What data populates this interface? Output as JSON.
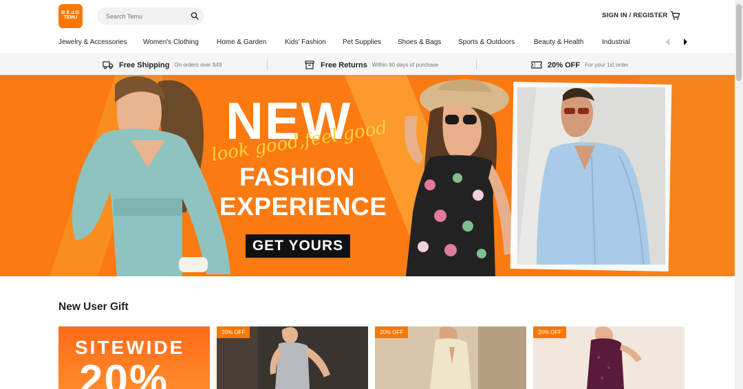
{
  "header": {
    "logo_line1": "⊠⊻⊿⊡",
    "logo_line2": "TEMU",
    "search_placeholder": "Search Temu",
    "signin_label": "SIGN IN / REGISTER"
  },
  "categories": [
    "Jewelry & Accessories",
    "Women's Clothing",
    "Home & Garden",
    "Kids' Fashion",
    "Pet Supplies",
    "Shoes & Bags",
    "Sports & Outdoors",
    "Beauty & Health",
    "Industrial"
  ],
  "benefits": [
    {
      "title": "Free Shipping",
      "sub": "On orders over $49",
      "icon": "truck-icon"
    },
    {
      "title": "Free Returns",
      "sub": "Within 90 days of purchase",
      "icon": "return-box-icon"
    },
    {
      "title": "20% OFF",
      "sub": "For your 1st order",
      "icon": "coupon-icon"
    }
  ],
  "banner": {
    "title": "NEW",
    "script": "look good,feel good",
    "subtitle1": "FASHION",
    "subtitle2": "EXPERIENCE",
    "cta": "GET YOURS"
  },
  "section": {
    "title": "New User Gift",
    "promo_text": "SITEWIDE",
    "promo_big": "20%",
    "cards": [
      {
        "badge": "20% OFF"
      },
      {
        "badge": "20% OFF"
      },
      {
        "badge": "20% OFF"
      }
    ]
  },
  "colors": {
    "brand": "#fb7701",
    "banner": "#fb7a12",
    "script": "#ffd23f"
  }
}
